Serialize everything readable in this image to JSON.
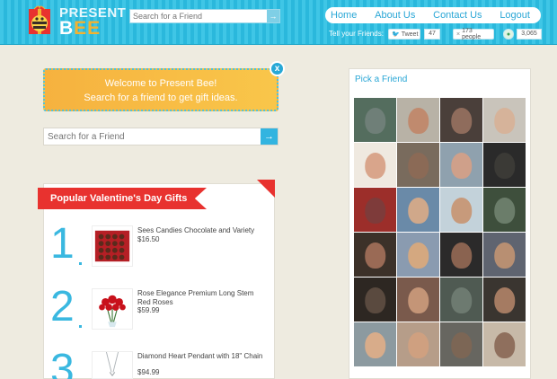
{
  "header": {
    "logo_line1": "PRESENT",
    "logo_line2_a": "B",
    "logo_line2_e": "EE",
    "search_placeholder": "Search for a Friend",
    "search_button": "→",
    "nav": [
      "Home",
      "About Us",
      "Contact Us",
      "Logout"
    ],
    "tell_label": "Tell your Friends:",
    "tweet_label": "Tweet",
    "tweet_count": "47",
    "fb_label": "173 people",
    "digg_count": "3,065"
  },
  "welcome": {
    "line1": "Welcome to Present Bee!",
    "line2": "Search for a friend to get gift ideas.",
    "close": "x"
  },
  "main_search": {
    "placeholder": "Search for a Friend",
    "button": "→"
  },
  "gifts": {
    "title": "Popular Valentine's Day Gifts",
    "items": [
      {
        "num": "1",
        "title": "Sees Candies Chocolate and Variety",
        "price": "$16.50",
        "image": "chocolate-box"
      },
      {
        "num": "2",
        "title": "Rose Elegance Premium Long Stem Red Roses",
        "price": "$59.99",
        "image": "red-roses"
      },
      {
        "num": "3",
        "title": "Diamond Heart Pendant with 18\" Chain",
        "price": "$94.99",
        "image": "heart-pendant"
      }
    ]
  },
  "pick_friend": {
    "title": "Pick a Friend",
    "friends_colors": [
      [
        "#6f7f78",
        "#c08a6e",
        "#8f6c5c",
        "#d6b39a"
      ],
      [
        "#d9a58b",
        "#8b6a56",
        "#cfa08a",
        "#3b3a36"
      ],
      [
        "#7e3b3a",
        "#d0a88a",
        "#c79a7b",
        "#6b7d6a"
      ],
      [
        "#9a6a55",
        "#d4a880",
        "#8a6350",
        "#b88f72"
      ],
      [
        "#5a4a3f",
        "#c49577",
        "#6d7a70",
        "#a57b62"
      ],
      [
        "#d8ac8a",
        "#cfa080",
        "#7c6655",
        "#8f6f5d"
      ]
    ],
    "backgrounds": [
      [
        "#546d5e",
        "#b8b2a6",
        "#4a3f3a",
        "#c9c4bb"
      ],
      [
        "#efe9e0",
        "#796b5d",
        "#8fa1ae",
        "#2a2a2a"
      ],
      [
        "#9c2e2a",
        "#6a8aa8",
        "#c3d2da",
        "#3e4f3c"
      ],
      [
        "#3c3129",
        "#8a9bb0",
        "#2b2a2a",
        "#5f6470"
      ],
      [
        "#2d2722",
        "#7a5a4c",
        "#4f5a52",
        "#3a3530"
      ],
      [
        "#8c9aa0",
        "#b69d89",
        "#676660",
        "#c7b9a8"
      ]
    ]
  }
}
